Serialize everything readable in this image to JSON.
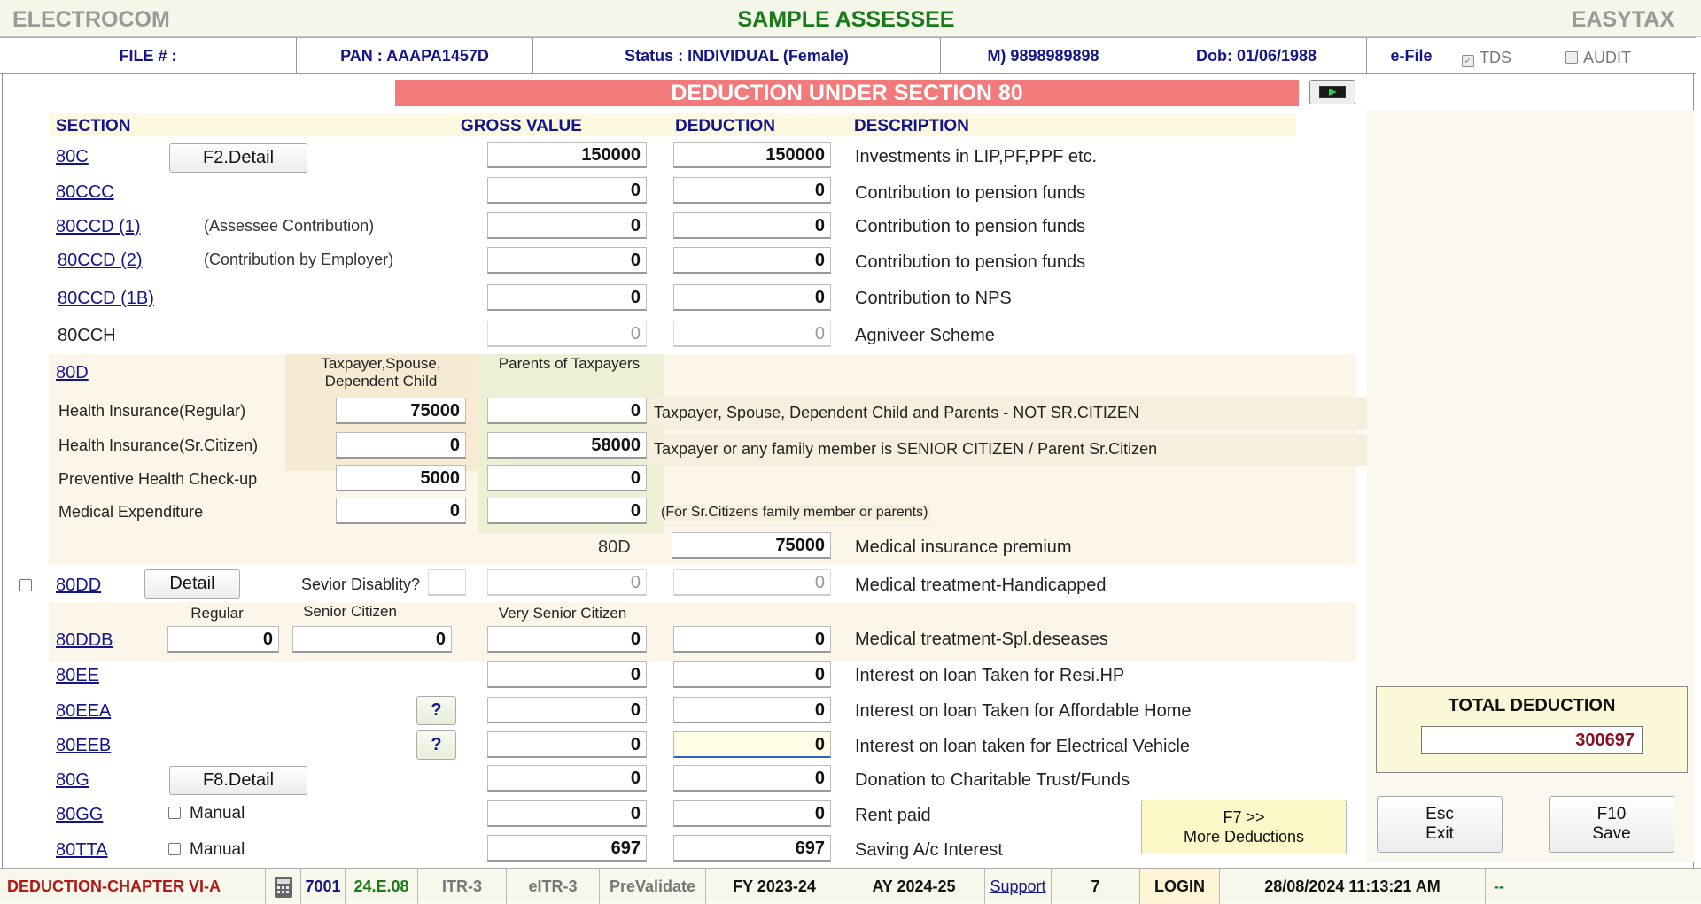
{
  "titlebar": {
    "app": "ELECTROCOM",
    "assessee": "SAMPLE ASSESSEE",
    "brand": "EASYTAX"
  },
  "info": {
    "file": "FILE # :",
    "pan": "PAN : AAAPA1457D",
    "status": "Status : INDIVIDUAL (Female)",
    "mobile": "M) 9898989898",
    "dob": "Dob: 01/06/1988",
    "efile": "e-File",
    "tds": "TDS",
    "audit": "AUDIT"
  },
  "banner": "DEDUCTION UNDER SECTION 80",
  "headers": {
    "section": "SECTION",
    "gross": "GROSS VALUE",
    "deduction": "DEDUCTION",
    "description": "DESCRIPTION"
  },
  "rows": {
    "c": {
      "sec": "80C",
      "btn": "F2.Detail",
      "gross": "150000",
      "ded": "150000",
      "desc": "Investments in LIP,PF,PPF etc."
    },
    "ccc": {
      "sec": "80CCC",
      "gross": "0",
      "ded": "0",
      "desc": "Contribution to pension funds"
    },
    "ccd1": {
      "sec": "80CCD (1)",
      "note": "(Assessee Contribution)",
      "gross": "0",
      "ded": "0",
      "desc": "Contribution to pension funds"
    },
    "ccd2": {
      "sec": "80CCD (2)",
      "note": "(Contribution by Employer)",
      "gross": "0",
      "ded": "0",
      "desc": "Contribution to pension funds"
    },
    "ccd1b": {
      "sec": "80CCD (1B)",
      "gross": "0",
      "ded": "0",
      "desc": "Contribution to NPS"
    },
    "cch": {
      "sec": "80CCH",
      "gross": "0",
      "ded": "0",
      "desc": "Agniveer Scheme"
    }
  },
  "d80": {
    "sec": "80D",
    "col1": "Taxpayer,Spouse, Dependent Child",
    "col2": "Parents of Taxpayers",
    "lines": [
      {
        "label": "Health Insurance(Regular)",
        "a": "75000",
        "b": "0",
        "desc": "Taxpayer, Spouse, Dependent Child and Parents - NOT SR.CITIZEN"
      },
      {
        "label": "Health Insurance(Sr.Citizen)",
        "a": "0",
        "b": "58000",
        "desc": "Taxpayer or any family member is SENIOR CITIZEN / Parent Sr.Citizen"
      },
      {
        "label": "Preventive Health Check-up",
        "a": "5000",
        "b": "0",
        "desc": ""
      },
      {
        "label": "Medical Expenditure",
        "a": "0",
        "b": "0",
        "desc": "(For Sr.Citizens family member or parents)"
      }
    ],
    "total_label": "80D",
    "total": "75000",
    "total_desc": "Medical insurance premium"
  },
  "dd": {
    "sec": "80DD",
    "btn": "Detail",
    "q": "Sevior Disablity?",
    "gross": "0",
    "ded": "0",
    "desc": "Medical treatment-Handicapped"
  },
  "ddb": {
    "sec": "80DDB",
    "regular": "Regular",
    "senior": "Senior Citizen",
    "very": "Very Senior Citizen",
    "reg_val": "0",
    "sen_val": "0",
    "gross": "0",
    "ded": "0",
    "desc": "Medical treatment-Spl.deseases"
  },
  "ee": {
    "sec": "80EE",
    "gross": "0",
    "ded": "0",
    "desc": "Interest on loan Taken for Resi.HP"
  },
  "eea": {
    "sec": "80EEA",
    "q": "?",
    "gross": "0",
    "ded": "0",
    "desc": "Interest on loan Taken for Affordable Home"
  },
  "eeb": {
    "sec": "80EEB",
    "q": "?",
    "gross": "0",
    "ded": "0",
    "desc": "Interest on loan taken for Electrical Vehicle"
  },
  "g": {
    "sec": "80G",
    "btn": "F8.Detail",
    "gross": "0",
    "ded": "0",
    "desc": "Donation to Charitable Trust/Funds"
  },
  "gg": {
    "sec": "80GG",
    "manual": "Manual",
    "gross": "0",
    "ded": "0",
    "desc": "Rent paid"
  },
  "tta": {
    "sec": "80TTA",
    "manual": "Manual",
    "gross": "697",
    "ded": "697",
    "desc": "Saving A/c Interest"
  },
  "more_btn": {
    "line1": "F7  >>",
    "line2": "More Deductions"
  },
  "total": {
    "label": "TOTAL DEDUCTION",
    "value": "300697"
  },
  "exit_btn": {
    "line1": "Esc",
    "line2": "Exit"
  },
  "save_btn": {
    "line1": "F10",
    "line2": "Save"
  },
  "status": {
    "module": "DEDUCTION-CHAPTER VI-A",
    "code": "7001",
    "version": "24.E.08",
    "itr": "ITR-3",
    "eitr": "eITR-3",
    "prevalidate": "PreValidate",
    "fy": "FY 2023-24",
    "ay": "AY 2024-25",
    "support": "Support",
    "num": "7",
    "login": "LOGIN",
    "datetime": "28/08/2024 11:13:21 AM",
    "extra": "--"
  },
  "colors": {
    "banner": "#f27a7a",
    "header_text": "#15158a",
    "title_green": "#1a7a1a",
    "total_value": "#8a1020"
  }
}
